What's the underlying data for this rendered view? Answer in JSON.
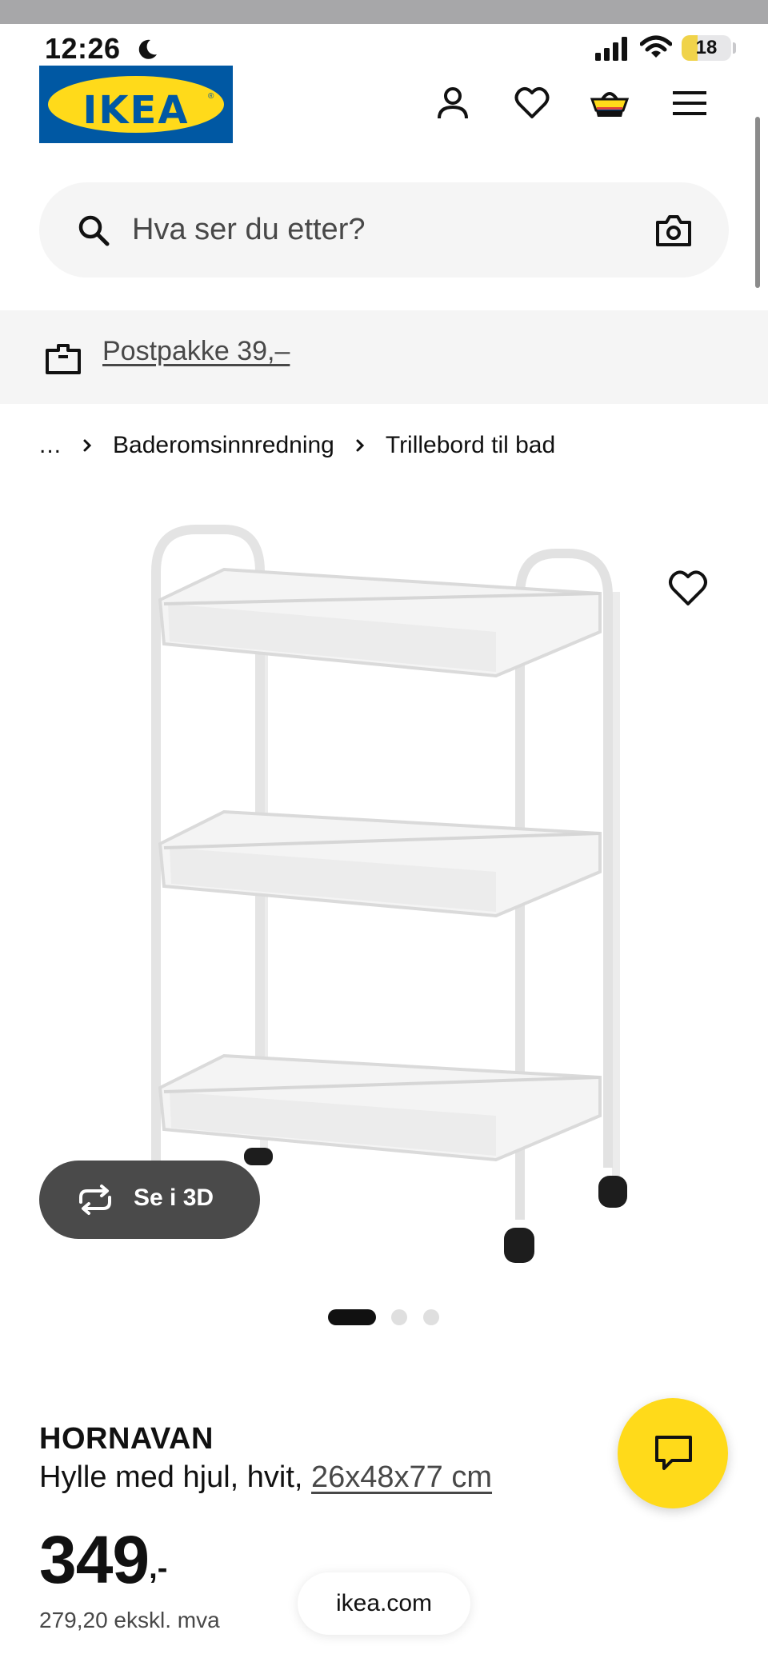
{
  "status_bar": {
    "time": "12:26",
    "battery_level": "18",
    "icons": [
      "moon-icon",
      "signal-icon",
      "wifi-icon",
      "battery-icon"
    ]
  },
  "header": {
    "logo_text": "IKEA",
    "logo_reg": "®",
    "colors": {
      "brand_blue": "#0058a3",
      "brand_yellow": "#ffda1a"
    },
    "icons": [
      "account-icon",
      "heart-icon",
      "cart-icon",
      "menu-icon"
    ]
  },
  "search": {
    "placeholder": "Hva ser du etter?"
  },
  "delivery_banner": {
    "label": "Postpakke 39,–"
  },
  "breadcrumb": {
    "items": [
      "...",
      "Baderomsinnredning",
      "Trillebord til bad"
    ]
  },
  "gallery": {
    "view_3d_label": "Se i 3D",
    "slide_count": 3,
    "active_slide": 1
  },
  "product": {
    "name": "HORNAVAN",
    "description": "Hylle med hjul, hvit, ",
    "size": "26x48x77 cm",
    "price_integer": "349",
    "price_decimal": ",-",
    "price_ex_vat": "279,20 ekskl. mva"
  },
  "browser": {
    "url": "ikea.com"
  }
}
